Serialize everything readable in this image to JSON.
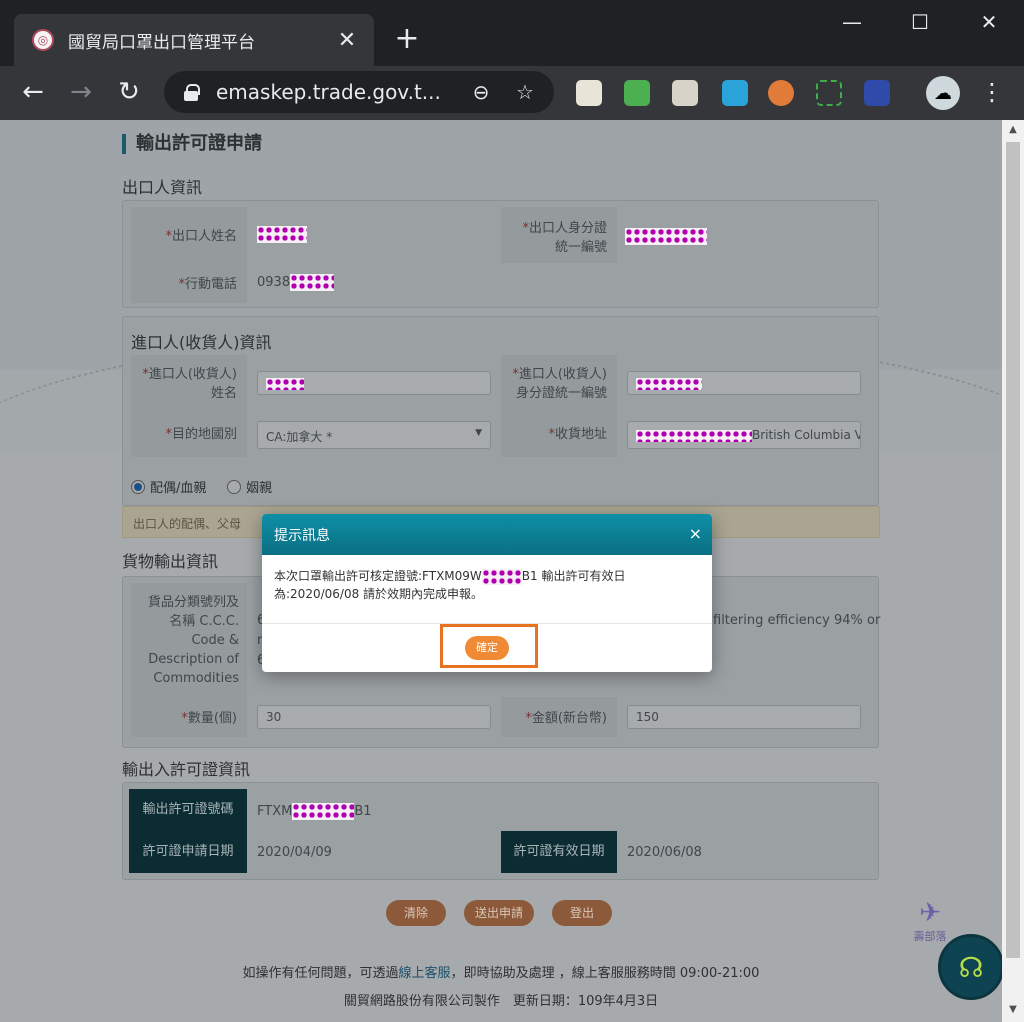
{
  "browser": {
    "tab_title": "國貿局口罩出口管理平台",
    "tab_close": "✕",
    "new_tab": "+",
    "url": "emaskep.trade.gov.t...",
    "win_minimize": "—",
    "win_maximize": "☐",
    "win_close": "✕"
  },
  "page": {
    "title": "輸出許可證申請",
    "exporter_section": "出口人資訊",
    "exporter_name_label": "出口人姓名",
    "exporter_id_label_1": "出口人身分證",
    "exporter_id_label_2": "統一編號",
    "exporter_phone_label": "行動電話",
    "exporter_phone_value": "0938",
    "importer_section": "進口人(收貨人)資訊",
    "importer_name_label_1": "進口人(收貨人)",
    "importer_name_label_2": "姓名",
    "importer_id_label_1": "進口人(收貨人)",
    "importer_id_label_2": "身分證統一編號",
    "destination_label": "目的地國別",
    "destination_value": "CA:加拿大 *",
    "address_label": "收貨地址",
    "address_value": "British Columbia V",
    "relation_options": [
      "配偶/血親",
      "姻親"
    ],
    "notice_text": "出口人的配偶、父母",
    "goods_section": "貨物輸出資訊",
    "goods_label": [
      "貨品分類號列及",
      "名稱 C.C.C.",
      "Code &",
      "Description of",
      "Commodities"
    ],
    "goods_partial_text": "filtering efficiency 94% or",
    "goods_left_fragments": [
      "6",
      "n",
      "6"
    ],
    "quantity_label": "數量(個)",
    "quantity_value": "30",
    "amount_label": "金額(新台幣)",
    "amount_value": "150",
    "license_section": "輸出入許可證資訊",
    "license_no_label": "輸出許可證號碼",
    "license_no_prefix": "FTXM",
    "license_no_suffix": "B1",
    "apply_date_label": "許可證申請日期",
    "apply_date_value": "2020/04/09",
    "expiry_label": "許可證有效日期",
    "expiry_value": "2020/06/08",
    "buttons": {
      "clear": "清除",
      "submit": "送出申請",
      "logout": "登出"
    },
    "footer_line1_a": "如操作有任何問題，可透過",
    "footer_line1_link": "線上客服",
    "footer_line1_b": "，即時協助及處理 ，線上客服服務時間 09:00-21:00",
    "footer_line2": "關貿網路股份有限公司製作　更新日期：109年4月3日",
    "watermark": "壽部落"
  },
  "modal": {
    "title": "提示訊息",
    "close": "×",
    "message_a": "本次口罩輸出許可核定證號:FTXM09W",
    "message_b": "B1 輸出許可有效日",
    "message_c": "為:2020/06/08 請於效期內完成申報。",
    "confirm": "確定"
  },
  "colors": {
    "modal_header": "#0e8fa6",
    "confirm_button": "#f08a34",
    "highlight_frame": "#e8731f"
  }
}
